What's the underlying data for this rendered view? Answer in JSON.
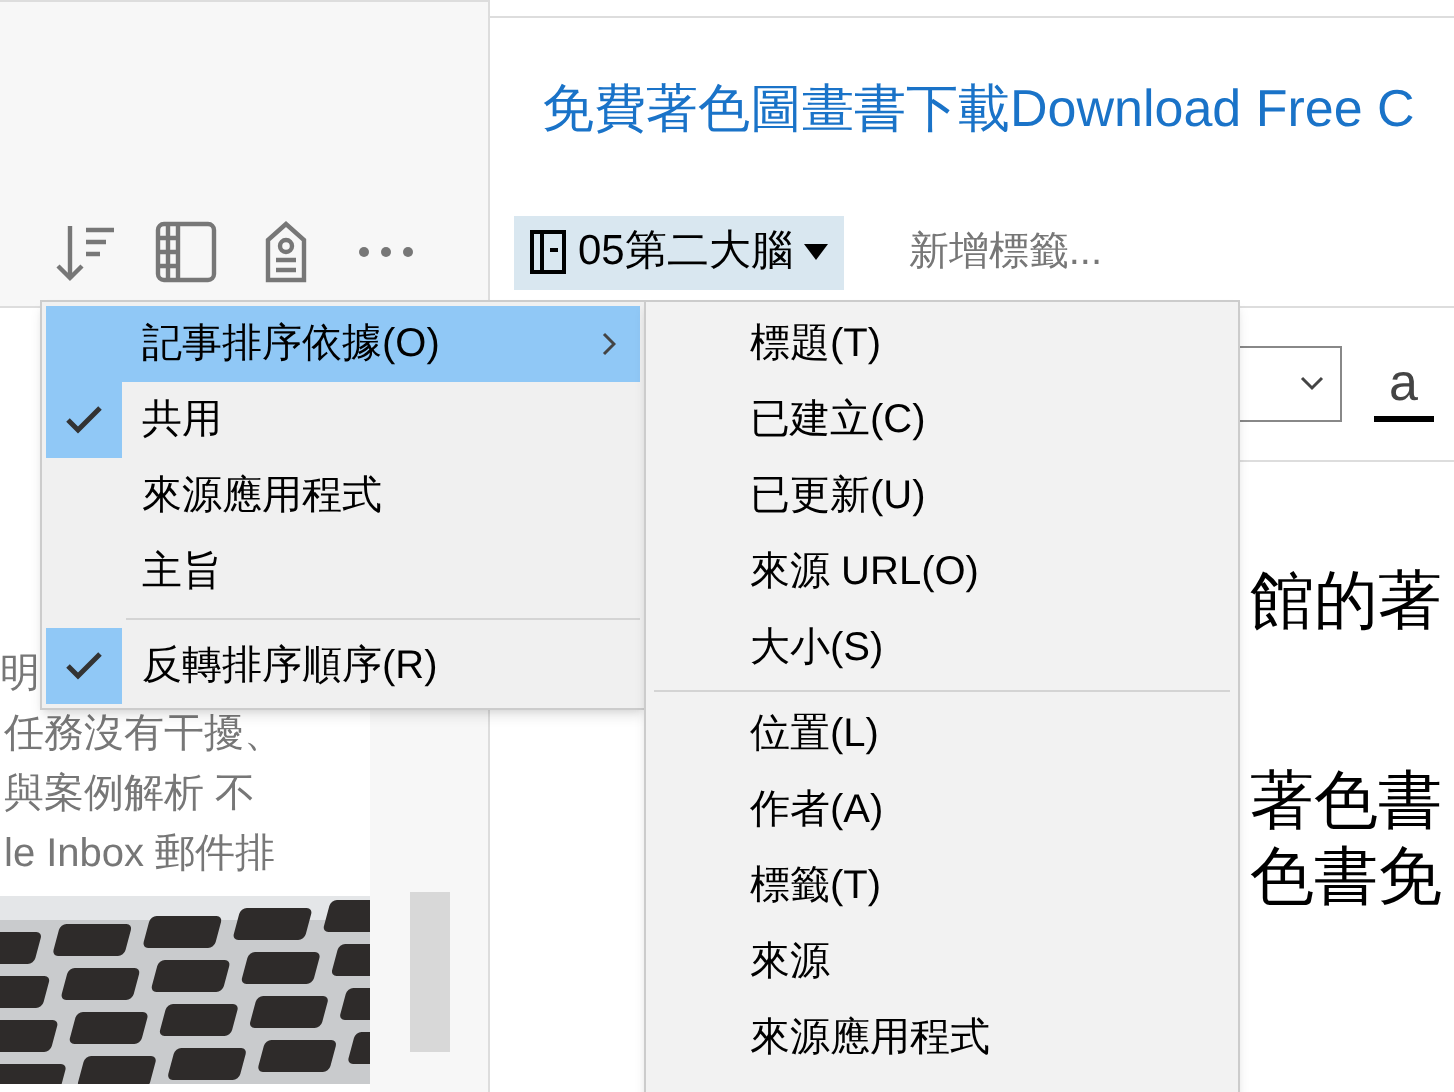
{
  "sidebar": {
    "note": {
      "lines": [
        "明",
        "任務沒有干擾、",
        "與案例解析 不",
        "le Inbox 郵件排"
      ],
      "thumbnail": {
        "kind": "picture"
      }
    }
  },
  "note_editor": {
    "title": "免費著色圖畫書下載Download Free C",
    "notebook": "05第二大腦",
    "add_tag": "新增標籤...",
    "format_sample": "a",
    "body": [
      "館的著",
      "著色書",
      "色書免"
    ]
  },
  "context_menu": {
    "items": [
      {
        "label": "記事排序依據(O)",
        "checked": false,
        "selected": true,
        "has_submenu": true,
        "separator_after": false
      },
      {
        "label": "共用",
        "checked": true,
        "selected": false,
        "has_submenu": false,
        "separator_after": false
      },
      {
        "label": "來源應用程式",
        "checked": false,
        "selected": false,
        "has_submenu": false,
        "separator_after": false
      },
      {
        "label": "主旨",
        "checked": false,
        "selected": false,
        "has_submenu": false,
        "separator_after": true
      },
      {
        "label": "反轉排序順序(R)",
        "checked": true,
        "selected": false,
        "has_submenu": false,
        "separator_after": false
      }
    ]
  },
  "submenu": {
    "items": [
      {
        "label": "標題(T)",
        "separator_after": false
      },
      {
        "label": "已建立(C)",
        "separator_after": false
      },
      {
        "label": "已更新(U)",
        "separator_after": false
      },
      {
        "label": "來源 URL(O)",
        "separator_after": false
      },
      {
        "label": "大小(S)",
        "separator_after": true
      },
      {
        "label": "位置(L)",
        "separator_after": false
      },
      {
        "label": "作者(A)",
        "separator_after": false
      },
      {
        "label": "標籤(T)",
        "separator_after": false
      },
      {
        "label": "來源",
        "separator_after": false
      },
      {
        "label": "來源應用程式",
        "separator_after": false
      }
    ]
  }
}
